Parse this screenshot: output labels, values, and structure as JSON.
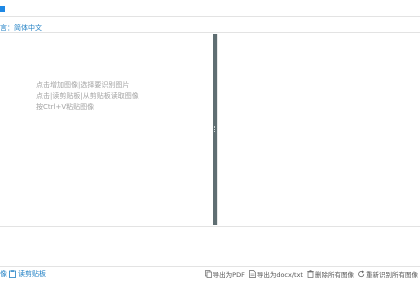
{
  "language": {
    "label": "言：",
    "value": "简体中文"
  },
  "hints": [
    "点击增加图像|选择要识别图片",
    "点击|读剪贴板|从剪贴板读取图像",
    "按Ctrl+V粘贴图像"
  ],
  "bottom_left": {
    "item1": "像",
    "item2": "读剪贴板"
  },
  "toolbar": {
    "export_pdf": "导出为PDF",
    "export_docx": "导出为docx/txt",
    "delete_all": "删除所有图像",
    "rerecognize": "重新识别所有图像"
  },
  "colors": {
    "accent": "#1e88e5",
    "divider": "#5f6e72",
    "link": "#1e7fc4"
  }
}
